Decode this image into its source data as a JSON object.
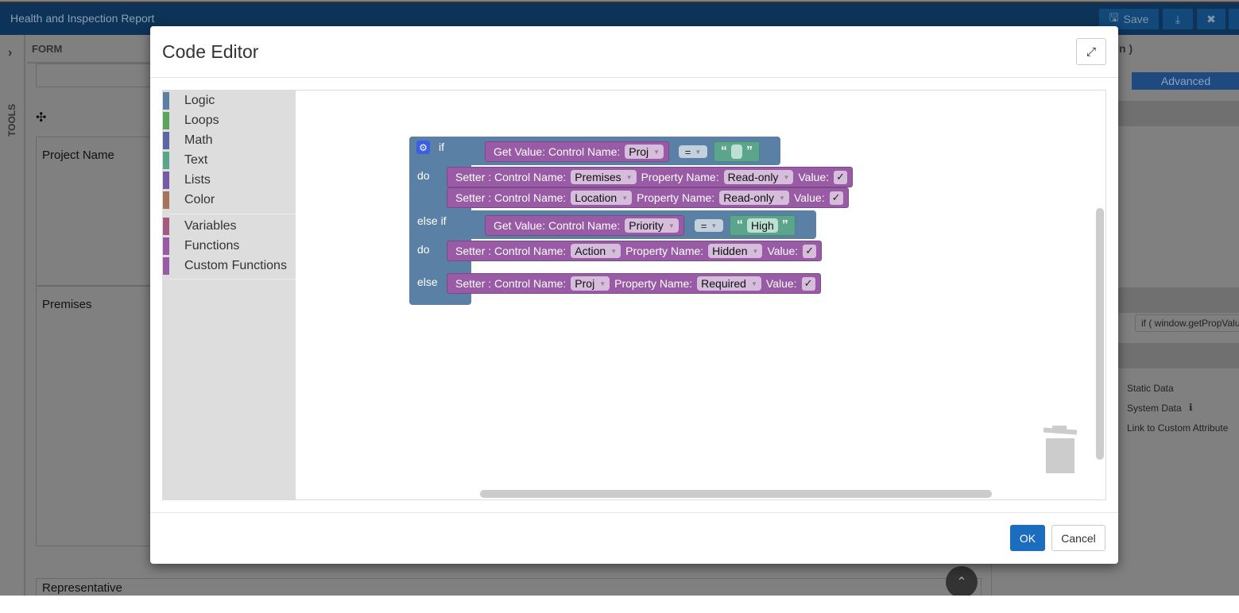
{
  "app": {
    "title": "Health and Inspection Report",
    "save_label": "Save",
    "tools_label": "TOOLS",
    "form_label": "FORM",
    "fields": [
      "Project Name",
      "Premises",
      "Representative"
    ],
    "right_panel": {
      "title_fragment": "n )",
      "tab_advanced": "Advanced",
      "code_preview": "if ( window.getPropValu",
      "radios": [
        "Static Data",
        "System Data",
        "Link to Custom Attribute"
      ]
    }
  },
  "modal": {
    "title": "Code Editor",
    "ok_label": "OK",
    "cancel_label": "Cancel",
    "categories": [
      {
        "label": "Logic",
        "color": "#5b80a5"
      },
      {
        "label": "Loops",
        "color": "#5ba55b"
      },
      {
        "label": "Math",
        "color": "#5b67a5"
      },
      {
        "label": "Text",
        "color": "#5ba58c"
      },
      {
        "label": "Lists",
        "color": "#745ba5"
      },
      {
        "label": "Color",
        "color": "#a5745b"
      },
      {
        "label": "Variables",
        "color": "#a55b80"
      },
      {
        "label": "Functions",
        "color": "#995ba5"
      },
      {
        "label": "Custom Functions",
        "color": "#995ba5"
      }
    ],
    "blocks": {
      "kw_if": "if",
      "kw_do": "do",
      "kw_elseif": "else if",
      "kw_else": "else",
      "get_label": "Get Value: Control Name:",
      "setter_label": "Setter : Control Name:",
      "prop_label": "Property Name:",
      "value_label": "Value:",
      "eq": "=",
      "check": "✓",
      "cond1": {
        "control": "Proj",
        "text": ""
      },
      "cond2": {
        "control": "Priority",
        "text": "High"
      },
      "setters": [
        {
          "control": "Premises",
          "property": "Read-only"
        },
        {
          "control": "Location",
          "property": "Read-only"
        },
        {
          "control": "Action",
          "property": "Hidden"
        },
        {
          "control": "Proj",
          "property": "Required"
        }
      ]
    }
  }
}
